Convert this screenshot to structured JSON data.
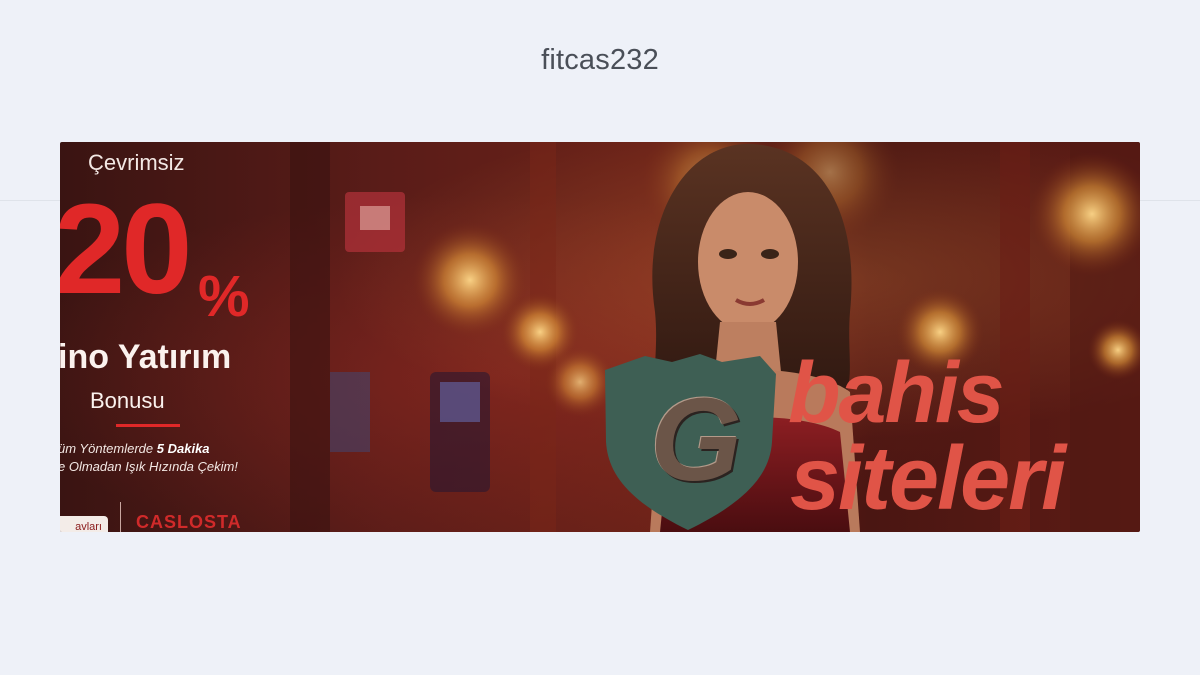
{
  "site": {
    "title": "fitcas232"
  },
  "banner": {
    "promo": {
      "lead": "Çevrimsiz",
      "big_number": "20",
      "percent_sign": "%",
      "line1": "ino Yatırım",
      "line2": "Bonusu",
      "small_line1_prefix": "üm Yöntemlerde ",
      "small_line1_bold": "5 Dakika",
      "small_line2": "e Olmadan Işık Hızında Çekim!",
      "button_label": "avları",
      "brand_logo": "CASLOSTA"
    },
    "watermark": {
      "letter": "G",
      "word1": "bahis",
      "word2": "siteleri"
    },
    "colors": {
      "promo_red": "#e02828",
      "watermark_red": "#e05447",
      "shield_green": "#3e5f54"
    }
  }
}
